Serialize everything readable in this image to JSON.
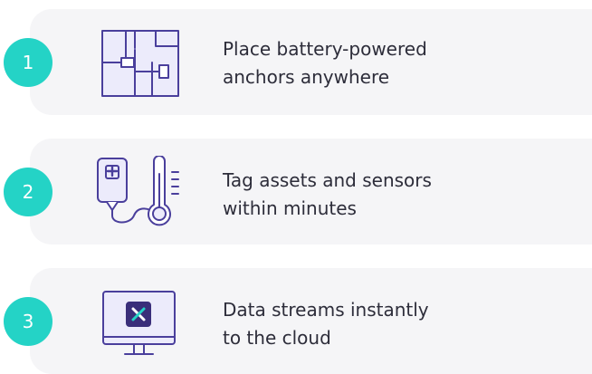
{
  "colors": {
    "accent": "#24d3c6",
    "icon_stroke": "#4a3f9c",
    "icon_fill": "#ecebfb",
    "card_bg": "#f5f5f7"
  },
  "steps": [
    {
      "number": "1",
      "icon": "floorplan-anchors-icon",
      "line1": "Place battery-powered",
      "line2": "anchors anywhere"
    },
    {
      "number": "2",
      "icon": "iv-bag-thermometer-icon",
      "line1": "Tag assets and sensors",
      "line2": "within minutes"
    },
    {
      "number": "3",
      "icon": "cloud-monitor-icon",
      "line1": "Data streams instantly",
      "line2": "to the cloud"
    }
  ]
}
